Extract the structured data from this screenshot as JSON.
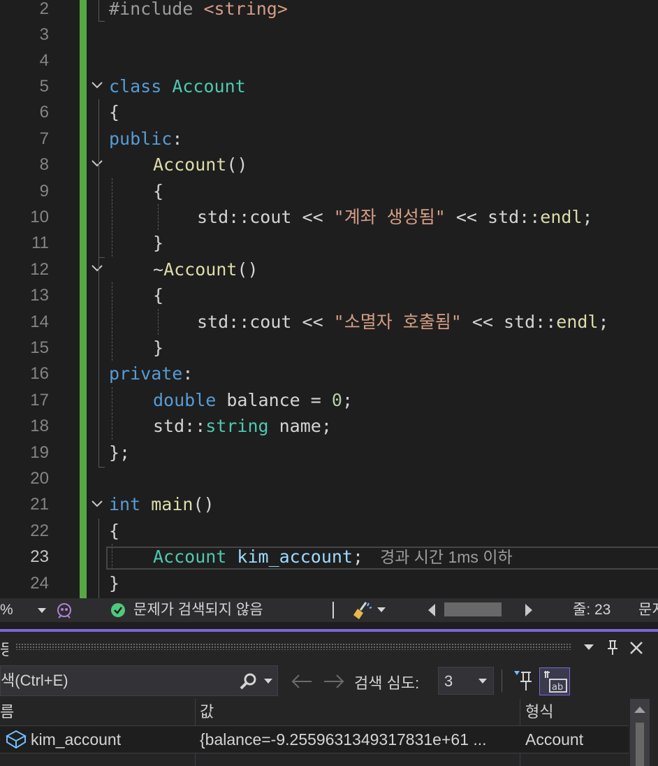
{
  "editor": {
    "line_numbers": [
      "2",
      "3",
      "4",
      "5",
      "6",
      "7",
      "8",
      "9",
      "10",
      "11",
      "12",
      "13",
      "14",
      "15",
      "16",
      "17",
      "18",
      "19",
      "20",
      "21",
      "22",
      "23",
      "24"
    ],
    "current_line": "23",
    "code": {
      "l2": [
        "#include",
        "<string>"
      ],
      "l5": [
        "class",
        "Account"
      ],
      "l6": "{",
      "l7": [
        "public",
        ":"
      ],
      "l8": [
        "Account",
        "()"
      ],
      "l9": "{",
      "l10": [
        "std::cout << ",
        "\"계좌 생성됨\"",
        " << std::",
        "endl",
        ";"
      ],
      "l11": "}",
      "l12": [
        "~",
        "Account",
        "()"
      ],
      "l13": "{",
      "l14": [
        "std::cout << ",
        "\"소멸자 호출됨\"",
        " << std::",
        "endl",
        ";"
      ],
      "l15": "}",
      "l16": [
        "private",
        ":"
      ],
      "l17": [
        "double",
        " balance = ",
        "0",
        ";"
      ],
      "l18": [
        "std::",
        "string",
        " name;"
      ],
      "l19": "};",
      "l21": [
        "int",
        " ",
        "main",
        "()"
      ],
      "l22": "{",
      "l23": [
        "Account",
        " ",
        "kim_account",
        ";"
      ],
      "l24": "}"
    },
    "elapsed_hint": "경과 시간 1ms 이하"
  },
  "status_bar": {
    "zoom": "%",
    "issues_text": "문제가 검색되지 않음",
    "line_label": "줄: 23",
    "truncated_right": "문지"
  },
  "watch_panel": {
    "title_fragment": "등",
    "search": {
      "placeholder": "색(Ctrl+E)"
    },
    "depth_label": "검색 심도:",
    "depth_value": "3",
    "columns": {
      "name": "름",
      "value": "값",
      "type": "형식"
    },
    "rows": [
      {
        "name": "kim_account",
        "value": "{balance=-9.2559631349317831e+61 ...",
        "type": "Account"
      }
    ]
  },
  "colors": {
    "editor_bg": "#1e1e1e",
    "change_bar": "#56a845",
    "panel_accent": "#7d66d9",
    "keyword": "#569cd6",
    "type": "#4ec9b0",
    "function": "#dcdcaa",
    "string": "#d69d85"
  }
}
